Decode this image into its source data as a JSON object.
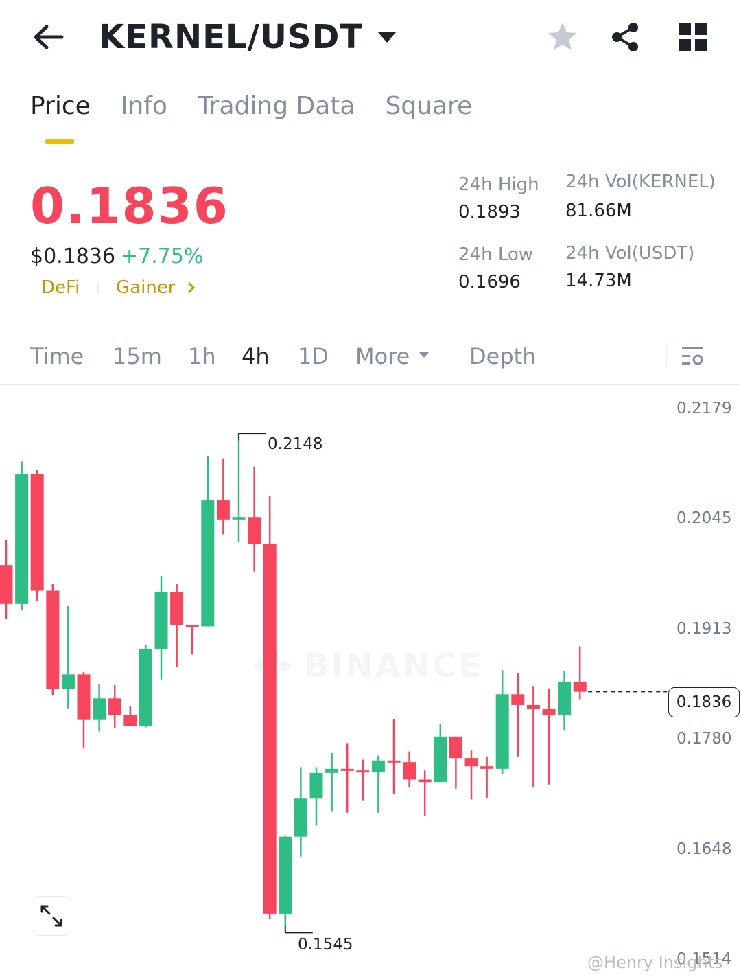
{
  "header": {
    "title": "KERNEL/USDT",
    "icons": [
      "back-arrow-icon",
      "caret-down-icon",
      "star-icon",
      "share-icon",
      "grid-icon"
    ]
  },
  "tabs": [
    {
      "label": "Price",
      "active": true
    },
    {
      "label": "Info",
      "active": false
    },
    {
      "label": "Trading Data",
      "active": false
    },
    {
      "label": "Square",
      "active": false
    }
  ],
  "ticker": {
    "last_price": "0.1836",
    "usd_price": "$0.1836",
    "change": "+7.75%",
    "tags": [
      "DeFi",
      "Gainer"
    ],
    "high_label": "24h High",
    "high_value": "0.1893",
    "low_label": "24h Low",
    "low_value": "0.1696",
    "vol_base_label": "24h Vol(KERNEL)",
    "vol_base_value": "81.66M",
    "vol_quote_label": "24h Vol(USDT)",
    "vol_quote_value": "14.73M"
  },
  "intervals": {
    "items": [
      "Time",
      "15m",
      "1h",
      "4h",
      "1D",
      "More",
      "Depth"
    ],
    "active": "4h"
  },
  "chart": {
    "y_ticks": [
      "0.2179",
      "0.2045",
      "0.1913",
      "0.1780",
      "0.1648",
      "0.1514"
    ],
    "current_price": "0.1836",
    "high_marker": "0.2148",
    "low_marker": "0.1545",
    "watermark": "BINANCE",
    "colors": {
      "up": "#2ebd85",
      "down": "#f6465d"
    }
  },
  "credit": "@Henry Insights",
  "chart_data": {
    "type": "candlestick",
    "interval": "4h",
    "ylim": [
      0.1514,
      0.2179
    ],
    "candles": [
      {
        "o": 0.1989,
        "h": 0.2019,
        "l": 0.1924,
        "c": 0.1942
      },
      {
        "o": 0.1942,
        "h": 0.2114,
        "l": 0.1935,
        "c": 0.2099
      },
      {
        "o": 0.2099,
        "h": 0.2104,
        "l": 0.1946,
        "c": 0.1958
      },
      {
        "o": 0.1958,
        "h": 0.1966,
        "l": 0.1832,
        "c": 0.1839
      },
      {
        "o": 0.1839,
        "h": 0.194,
        "l": 0.1816,
        "c": 0.1857
      },
      {
        "o": 0.1857,
        "h": 0.186,
        "l": 0.1768,
        "c": 0.1802
      },
      {
        "o": 0.1802,
        "h": 0.1845,
        "l": 0.1788,
        "c": 0.1828
      },
      {
        "o": 0.1828,
        "h": 0.1844,
        "l": 0.1792,
        "c": 0.1808
      },
      {
        "o": 0.1808,
        "h": 0.1819,
        "l": 0.1795,
        "c": 0.1795
      },
      {
        "o": 0.1795,
        "h": 0.1893,
        "l": 0.1793,
        "c": 0.1888
      },
      {
        "o": 0.1888,
        "h": 0.1976,
        "l": 0.1851,
        "c": 0.1956
      },
      {
        "o": 0.1956,
        "h": 0.1966,
        "l": 0.1866,
        "c": 0.1917
      },
      {
        "o": 0.1917,
        "h": 0.1915,
        "l": 0.1881,
        "c": 0.1915
      },
      {
        "o": 0.1915,
        "h": 0.2121,
        "l": 0.1938,
        "c": 0.2067
      },
      {
        "o": 0.2067,
        "h": 0.2118,
        "l": 0.2026,
        "c": 0.2044
      },
      {
        "o": 0.2044,
        "h": 0.2148,
        "l": 0.2017,
        "c": 0.2047
      },
      {
        "o": 0.2047,
        "h": 0.2108,
        "l": 0.1981,
        "c": 0.2014
      },
      {
        "o": 0.2014,
        "h": 0.2073,
        "l": 0.1562,
        "c": 0.1568
      },
      {
        "o": 0.1568,
        "h": 0.1662,
        "l": 0.1545,
        "c": 0.1661
      },
      {
        "o": 0.1661,
        "h": 0.1745,
        "l": 0.1637,
        "c": 0.1707
      },
      {
        "o": 0.1707,
        "h": 0.1745,
        "l": 0.1675,
        "c": 0.1738
      },
      {
        "o": 0.1738,
        "h": 0.1762,
        "l": 0.1691,
        "c": 0.1743
      },
      {
        "o": 0.1743,
        "h": 0.1774,
        "l": 0.169,
        "c": 0.1741
      },
      {
        "o": 0.1741,
        "h": 0.1754,
        "l": 0.1705,
        "c": 0.1739
      },
      {
        "o": 0.1739,
        "h": 0.1759,
        "l": 0.169,
        "c": 0.1753
      },
      {
        "o": 0.1753,
        "h": 0.1803,
        "l": 0.1713,
        "c": 0.1751
      },
      {
        "o": 0.1751,
        "h": 0.1764,
        "l": 0.1721,
        "c": 0.173
      },
      {
        "o": 0.173,
        "h": 0.1741,
        "l": 0.1686,
        "c": 0.1727
      },
      {
        "o": 0.1727,
        "h": 0.1797,
        "l": 0.1728,
        "c": 0.1782
      },
      {
        "o": 0.1782,
        "h": 0.1781,
        "l": 0.1719,
        "c": 0.1756
      },
      {
        "o": 0.1756,
        "h": 0.1765,
        "l": 0.1706,
        "c": 0.1746
      },
      {
        "o": 0.1746,
        "h": 0.1758,
        "l": 0.1708,
        "c": 0.1743
      },
      {
        "o": 0.1743,
        "h": 0.1862,
        "l": 0.1737,
        "c": 0.1833
      },
      {
        "o": 0.1833,
        "h": 0.1858,
        "l": 0.1758,
        "c": 0.182
      },
      {
        "o": 0.182,
        "h": 0.1843,
        "l": 0.1721,
        "c": 0.1815
      },
      {
        "o": 0.1815,
        "h": 0.184,
        "l": 0.1724,
        "c": 0.1808
      },
      {
        "o": 0.1808,
        "h": 0.1861,
        "l": 0.1789,
        "c": 0.1848
      },
      {
        "o": 0.1848,
        "h": 0.1891,
        "l": 0.1827,
        "c": 0.1836
      }
    ]
  }
}
